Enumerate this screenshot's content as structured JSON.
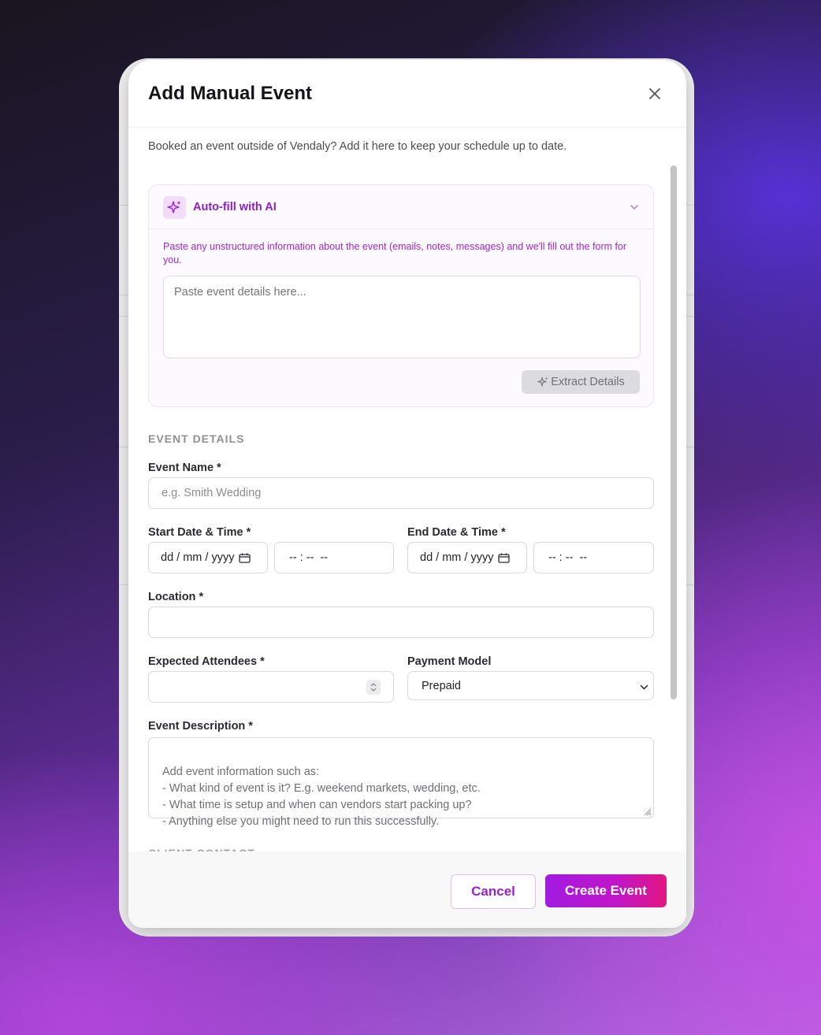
{
  "modal": {
    "title": "Add Manual Event",
    "intro": "Booked an event outside of Vendaly? Add it here to keep your schedule up to date."
  },
  "ai_fill": {
    "title": "Auto-fill with AI",
    "description": "Paste any unstructured information about the event (emails, notes, messages) and we'll fill out the form for you.",
    "placeholder": "Paste event details here...",
    "extract_label": "Extract Details"
  },
  "sections": {
    "event_details": "EVENT DETAILS",
    "client_contact": "CLIENT CONTACT"
  },
  "fields": {
    "event_name": {
      "label": "Event Name *",
      "placeholder": "e.g. Smith Wedding"
    },
    "start": {
      "label": "Start Date & Time *",
      "date": "dd / mm / yyyy",
      "time": "-- : --  --"
    },
    "end": {
      "label": "End Date & Time *",
      "date": "dd / mm / yyyy",
      "time": "-- : --  --"
    },
    "location": {
      "label": "Location *",
      "value": ""
    },
    "attendees": {
      "label": "Expected Attendees *",
      "value": ""
    },
    "payment_model": {
      "label": "Payment Model",
      "selected": "Prepaid"
    },
    "description": {
      "label": "Event Description *",
      "placeholder": "Add event information such as:\n- What kind of event is it? E.g. weekend markets, wedding, etc.\n- What time is setup and when can vendors start packing up?\n- Anything else you might need to run this successfully."
    }
  },
  "footer": {
    "cancel_label": "Cancel",
    "create_label": "Create Event"
  },
  "colors": {
    "accent": "#9a1fd0",
    "gradient_end": "#e2177f"
  }
}
